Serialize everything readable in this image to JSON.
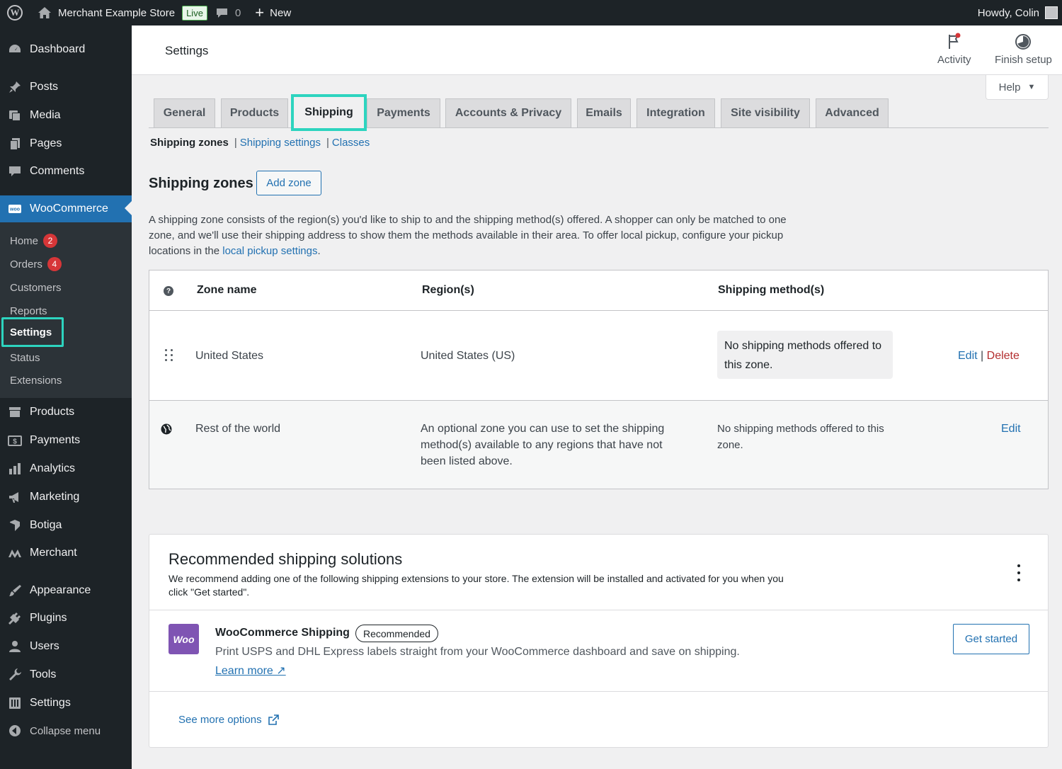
{
  "adminbar": {
    "site_name": "Merchant Example Store",
    "live_label": "Live",
    "comments_count": "0",
    "new_label": "New",
    "greeting": "Howdy, Colin"
  },
  "sidebar": {
    "items": {
      "dashboard": "Dashboard",
      "posts": "Posts",
      "media": "Media",
      "pages": "Pages",
      "comments": "Comments",
      "woocommerce": "WooCommerce",
      "products": "Products",
      "payments": "Payments",
      "analytics": "Analytics",
      "marketing": "Marketing",
      "botiga": "Botiga",
      "merchant": "Merchant",
      "appearance": "Appearance",
      "plugins": "Plugins",
      "users": "Users",
      "tools": "Tools",
      "settings": "Settings",
      "collapse": "Collapse menu"
    },
    "woo_submenu": {
      "home": "Home",
      "home_count": "2",
      "orders": "Orders",
      "orders_count": "4",
      "customers": "Customers",
      "reports": "Reports",
      "settings": "Settings",
      "status": "Status",
      "extensions": "Extensions"
    }
  },
  "header": {
    "title": "Settings",
    "activity_label": "Activity",
    "finish_setup_label": "Finish setup",
    "help_label": "Help"
  },
  "tabs": {
    "general": "General",
    "products": "Products",
    "shipping": "Shipping",
    "payments": "Payments",
    "accounts": "Accounts & Privacy",
    "emails": "Emails",
    "integration": "Integration",
    "site_visibility": "Site visibility",
    "advanced": "Advanced"
  },
  "subnav": {
    "zones": "Shipping zones",
    "settings": "Shipping settings",
    "classes": "Classes"
  },
  "zones": {
    "title": "Shipping zones",
    "add_zone_label": "Add zone",
    "description_before": "A shipping zone consists of the region(s) you'd like to ship to and the shipping method(s) offered. A shopper can only be matched to one zone, and we'll use their shipping address to show them the methods available in their area. To offer local pickup, configure your pickup locations in the ",
    "description_link": "local pickup settings",
    "description_after": ".",
    "columns": {
      "zone_name": "Zone name",
      "regions": "Region(s)",
      "methods": "Shipping method(s)"
    },
    "rows": [
      {
        "name": "United States",
        "region": "United States (US)",
        "methods": "No shipping methods offered to this zone.",
        "edit": "Edit",
        "separator": "|",
        "delete": "Delete"
      },
      {
        "name": "Rest of the world",
        "region": "An optional zone you can use to set the shipping method(s) available to any regions that have not been listed above.",
        "methods": "No shipping methods offered to this zone.",
        "edit": "Edit"
      }
    ]
  },
  "recommended": {
    "title": "Recommended shipping solutions",
    "subtitle": "We recommend adding one of the following shipping extensions to your store. The extension will be installed and activated for you when you click \"Get started\".",
    "extension": {
      "logo_text": "Woo",
      "name": "WooCommerce Shipping",
      "badge": "Recommended",
      "description": "Print USPS and DHL Express labels straight from your WooCommerce dashboard and save on shipping.",
      "learn_more": "Learn more ↗",
      "cta": "Get started"
    },
    "see_more": "See more options"
  },
  "colors": {
    "admin_dark": "#1d2327",
    "submenu_bg": "#2c3338",
    "accent_blue": "#2271b1",
    "highlight_teal": "#2dd4bf",
    "badge_red": "#d63638",
    "delete_red": "#b32d2e",
    "woo_purple": "#7f54b3"
  }
}
